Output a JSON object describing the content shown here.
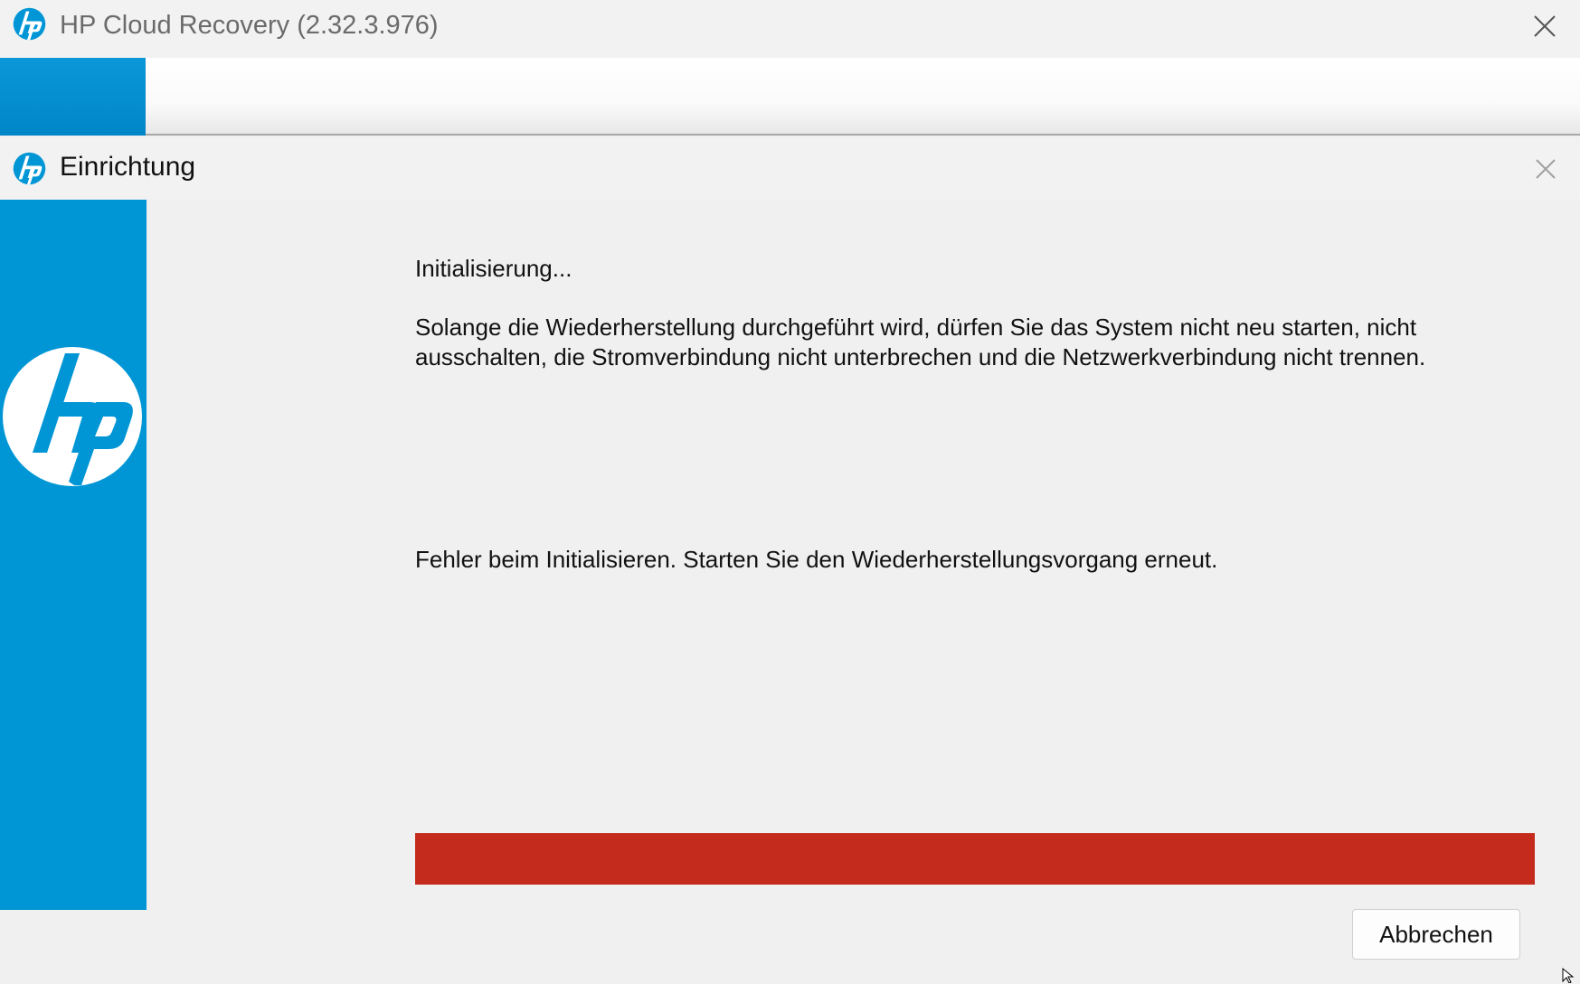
{
  "outer_window": {
    "title": "HP Cloud Recovery (2.32.3.976)",
    "logo_icon": "hp-logo-icon",
    "close_icon": "close-icon"
  },
  "dialog": {
    "title": "Einrichtung",
    "logo_icon": "hp-logo-icon",
    "close_icon": "close-icon",
    "sidebar_logo": "hp-logo",
    "status": "Initialisierung...",
    "warning": "Solange die Wiederherstellung durchgeführt wird, dürfen Sie das System nicht neu starten, nicht ausschalten, die Stromverbindung nicht unterbrechen und die Netzwerkverbindung nicht trennen.",
    "error": "Fehler beim Initialisieren. Starten Sie den Wiederherstellungsvorgang erneut.",
    "progress": {
      "value_percent": 100,
      "state": "error",
      "color": "#c42b1c"
    },
    "cancel_label": "Abbrechen"
  },
  "colors": {
    "hp_blue": "#0096d6",
    "error_red": "#c42b1c",
    "background": "#f0f0f0"
  }
}
